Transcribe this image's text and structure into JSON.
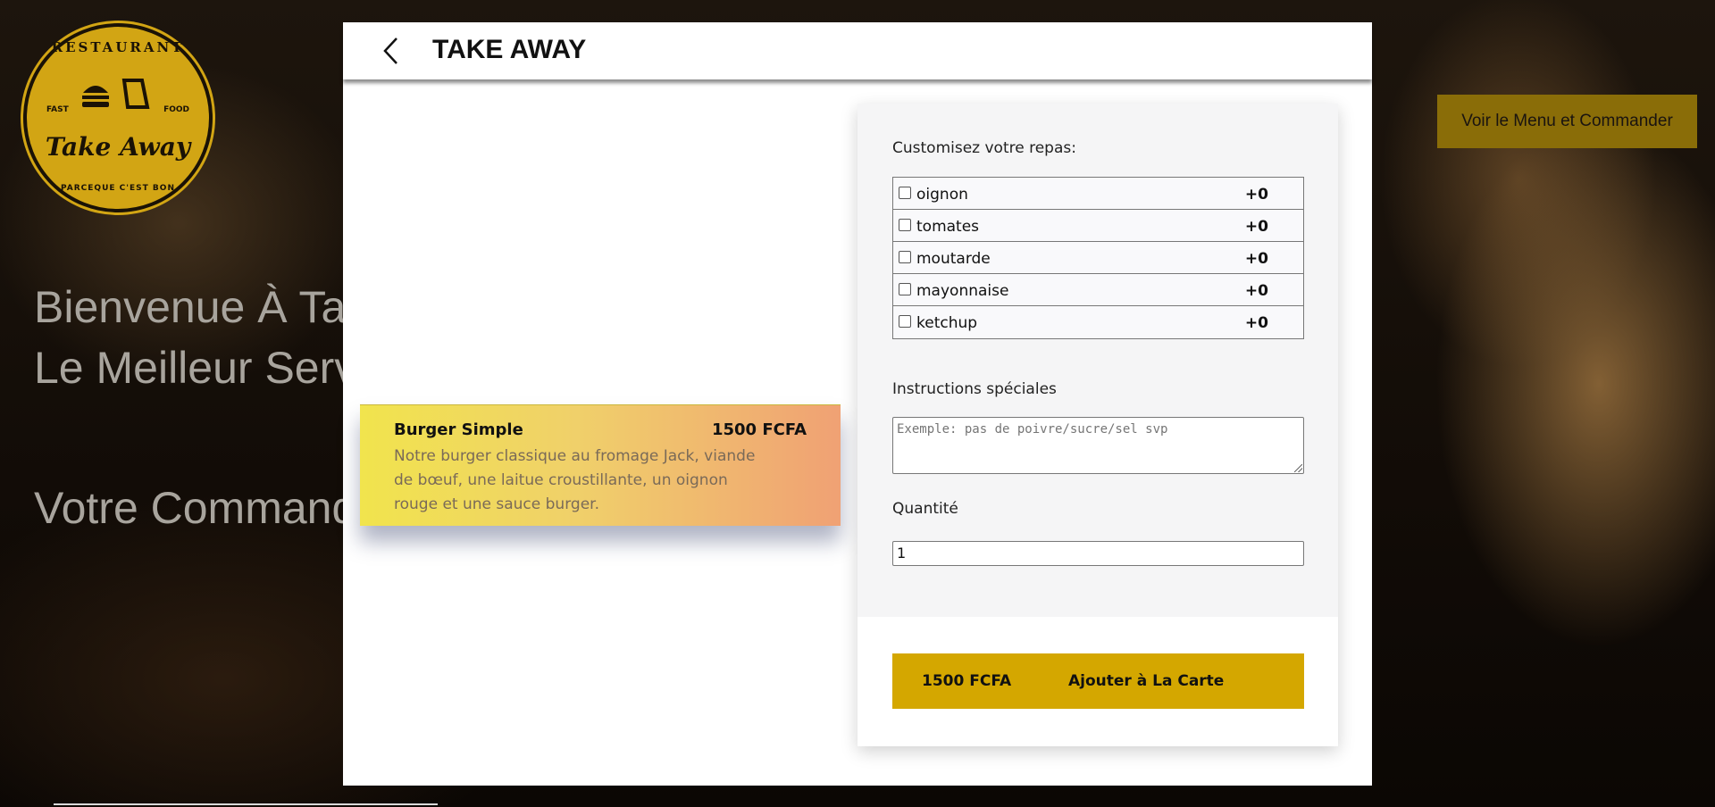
{
  "background": {
    "logo": {
      "ring_top": "RESTAURANT",
      "side_left": "FAST",
      "side_right": "FOOD",
      "script": "Take Away",
      "ring_bottom": "PARCEQUE C'EST BON"
    },
    "heading_line1": "Bienvenue À Tak",
    "heading_line2": "Le Meilleur Serv",
    "heading_line3": "Votre Command",
    "menu_button_label": "Voir le Menu et Commander"
  },
  "modal": {
    "title": "TAKE AWAY",
    "product": {
      "name": "Burger Simple",
      "price": "1500 FCFA",
      "description": "Notre burger classique au fromage Jack, viande de bœuf, une laitue croustillante, un oignon rouge et une sauce burger."
    },
    "customize": {
      "label": "Customisez votre repas:",
      "options": [
        {
          "name": "oignon",
          "price": "+0"
        },
        {
          "name": "tomates",
          "price": "+0"
        },
        {
          "name": "moutarde",
          "price": "+0"
        },
        {
          "name": "mayonnaise",
          "price": "+0"
        },
        {
          "name": "ketchup",
          "price": "+0"
        }
      ]
    },
    "instructions": {
      "label": "Instructions spéciales",
      "placeholder": "Exemple: pas de poivre/sucre/sel svp"
    },
    "quantity": {
      "label": "Quantité",
      "value": "1"
    },
    "add_button": {
      "price": "1500 FCFA",
      "label": "Ajouter à La Carte"
    }
  },
  "colors": {
    "accent": "#d4a700",
    "menu_button": "#8a6d08"
  }
}
